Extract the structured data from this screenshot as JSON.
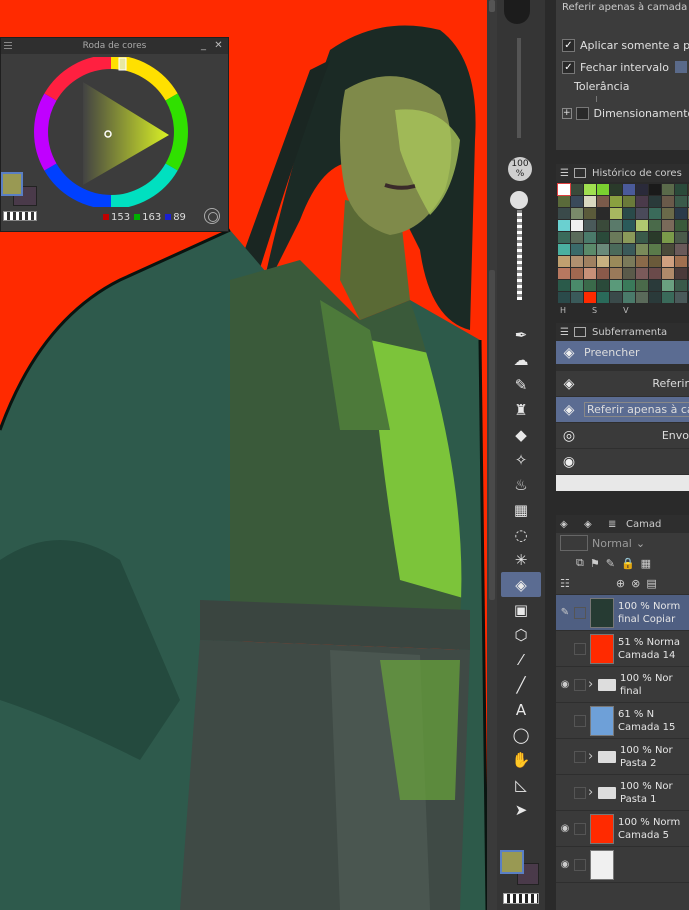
{
  "color_wheel": {
    "title": "Roda de cores",
    "r": "153",
    "g": "163",
    "b": "89",
    "main_color": "#999953",
    "sub_color": "#4a3a4a"
  },
  "mid": {
    "opacity": "100",
    "opacity_unit": "%"
  },
  "tool_property": {
    "top_text": "Referir apenas à camada de",
    "apply_only": "Aplicar somente a pix",
    "close_gap": "Fechar intervalo",
    "tolerance": "Tolerância",
    "resize": "Dimensionamento de"
  },
  "color_history": {
    "title": "Histórico de cores",
    "footer": [
      "H",
      "S",
      "V"
    ]
  },
  "subtool": {
    "title": "Subferramenta",
    "group": "Preencher",
    "items": [
      "Referir",
      "Referir apenas à ca",
      "Envo"
    ]
  },
  "layers": {
    "tab": "Camad",
    "blend_mode": "Normal",
    "rows": [
      {
        "pct": "100 % Norm",
        "name": "final Copiar",
        "color": "#263b33"
      },
      {
        "pct": "51 % Norma",
        "name": "Camada 14",
        "color": "#ff2a00"
      },
      {
        "pct": "100 % Nor",
        "name": "final",
        "color": "#f0c040"
      },
      {
        "pct": "61 % N",
        "name": "Camada 15",
        "color": "#6ea0d8"
      },
      {
        "pct": "100 % Nor",
        "name": "Pasta 2",
        "color": "#f0c040"
      },
      {
        "pct": "100 % Nor",
        "name": "Pasta 1",
        "color": "#f0c040"
      },
      {
        "pct": "100 % Norm",
        "name": "Camada 5",
        "color": "#ff2a00"
      },
      {
        "pct": "",
        "name": "",
        "color": "#f0f0f0"
      }
    ]
  }
}
